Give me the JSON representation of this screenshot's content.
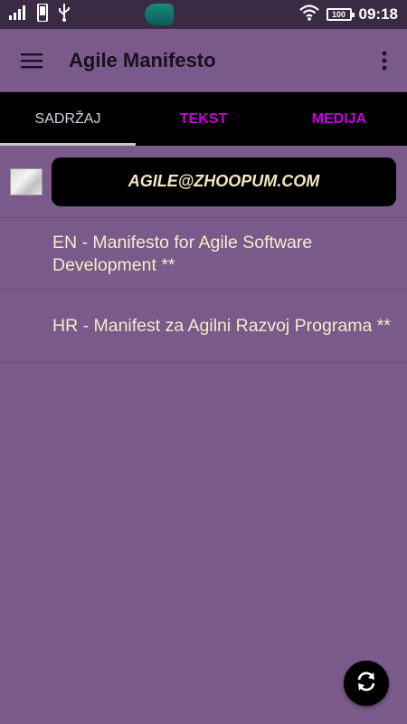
{
  "status_bar": {
    "time": "09:18",
    "battery": "100",
    "icons": [
      "signal-icon",
      "phone-icon",
      "usb-icon",
      "wifi-icon",
      "battery-icon"
    ]
  },
  "app_bar": {
    "title": "Agile Manifesto",
    "menu_icon": "hamburger-icon",
    "overflow_icon": "more-vert-icon"
  },
  "tabs": [
    {
      "label": "SADRŽAJ",
      "active": true
    },
    {
      "label": "TEKST",
      "active": false
    },
    {
      "label": "MEDIJA",
      "active": false
    }
  ],
  "content": {
    "email_button": "AGILE@ZHOOPUM.COM",
    "items": [
      {
        "label": "EN - Manifesto for Agile Software Development **"
      },
      {
        "label": "HR - Manifest za Agilni Razvoj Programa **"
      }
    ]
  },
  "fab": {
    "icon": "refresh-icon"
  },
  "colors": {
    "background": "#7a5a8a",
    "tab_bar": "#000000",
    "inactive_tab": "#c800e0",
    "list_text": "#f7ecc8",
    "email_text": "#f5e6c0"
  }
}
